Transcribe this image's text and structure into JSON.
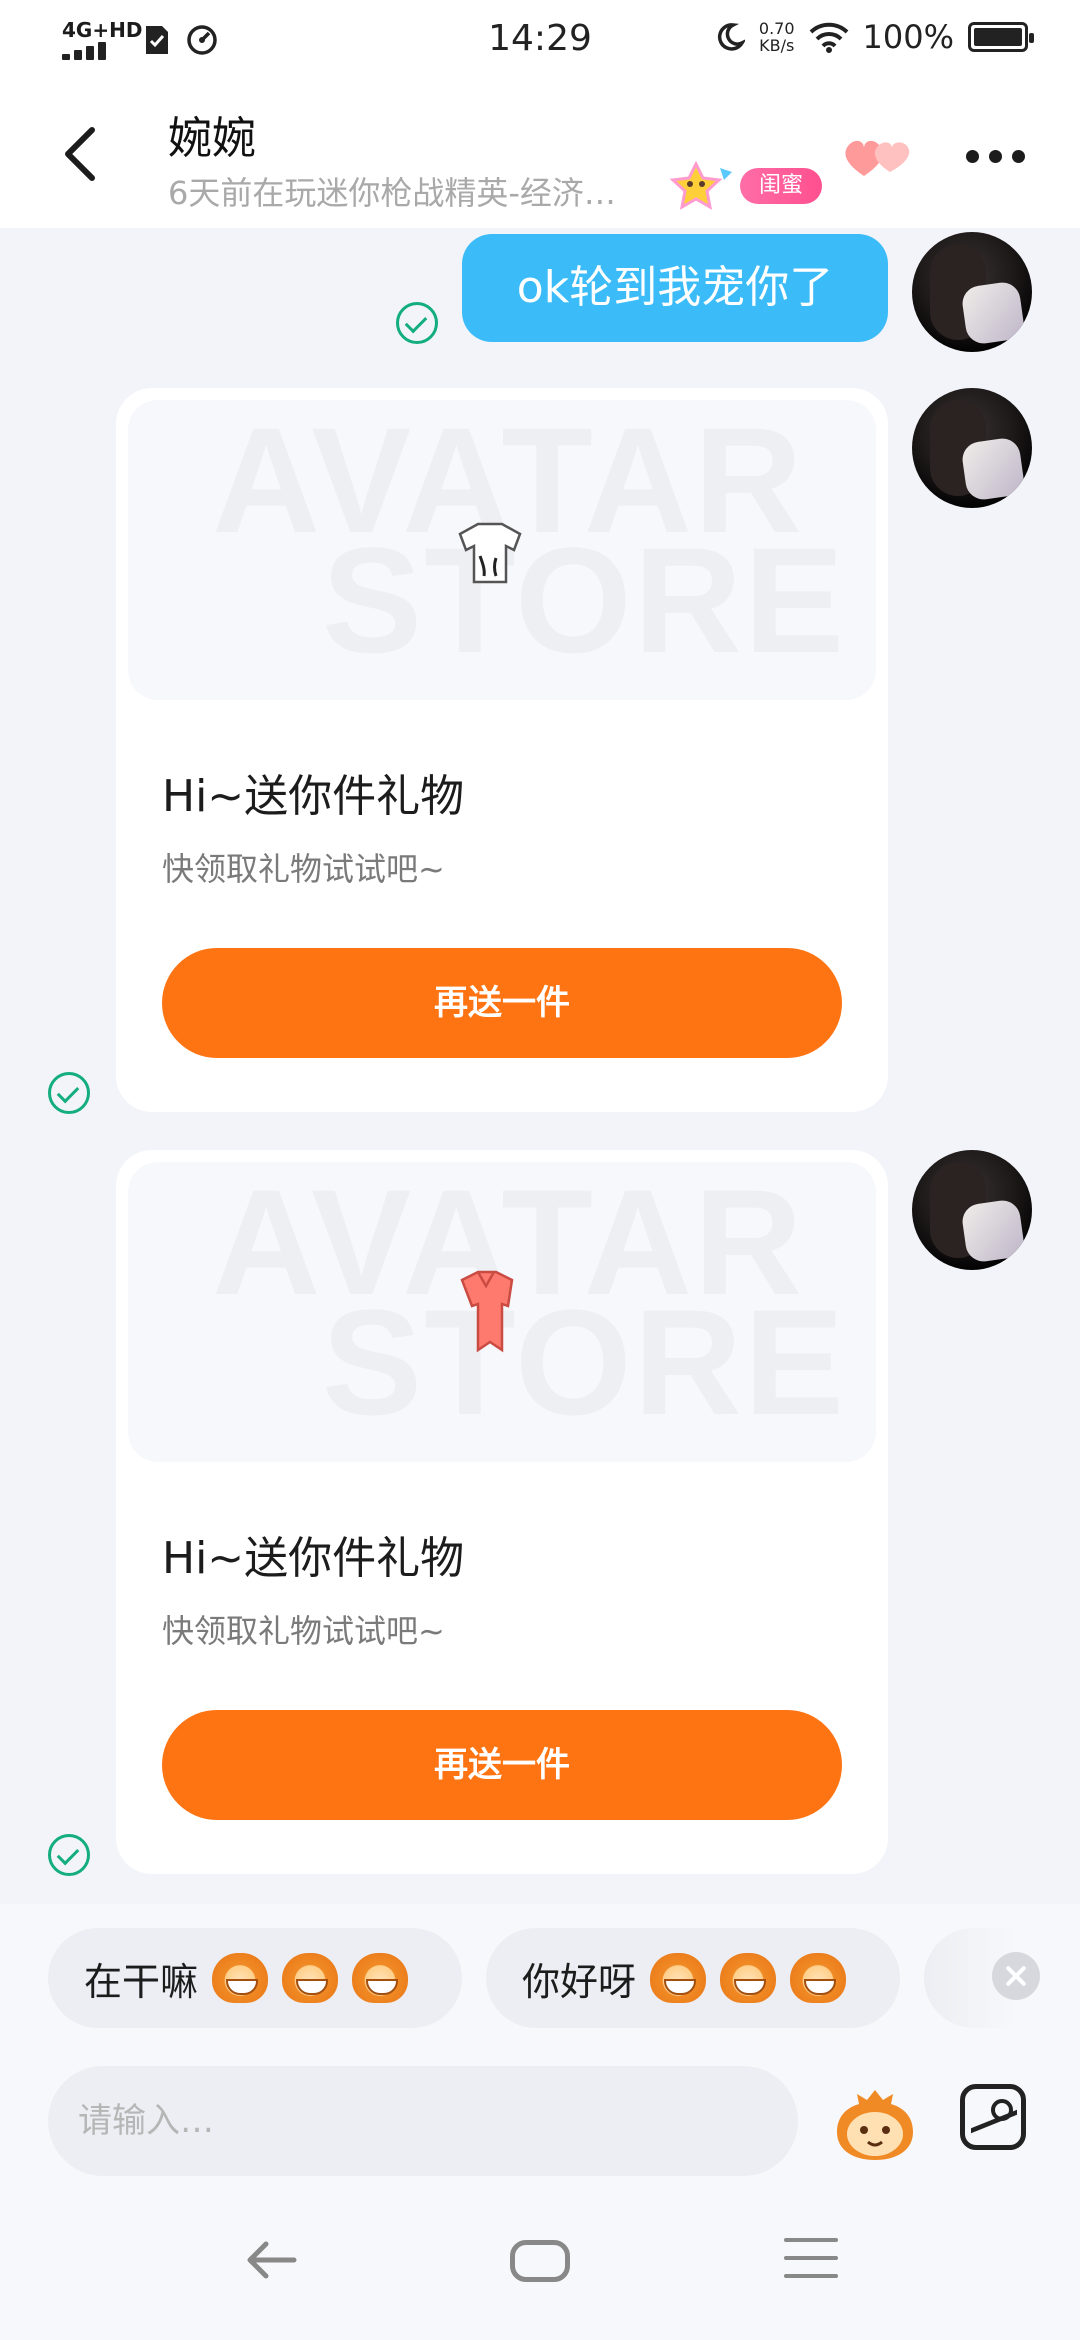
{
  "status_bar": {
    "network": "4G+HD",
    "time": "14:29",
    "speed_value": "0.70",
    "speed_unit": "KB/s",
    "battery": "100%"
  },
  "header": {
    "name": "婉婉",
    "subtitle": "6天前在玩迷你枪战精英-经济…",
    "relation_badge": "闺蜜"
  },
  "messages": {
    "text_bubble": "ok轮到我宠你了",
    "gift_cards": [
      {
        "watermark_line1": "AVATAR",
        "watermark_line2": "STORE",
        "title": "Hi~送你件礼物",
        "desc": "快领取礼物试试吧~",
        "button": "再送一件",
        "item_icon": "white-crop-top-icon"
      },
      {
        "watermark_line1": "AVATAR",
        "watermark_line2": "STORE",
        "title": "Hi~送你件礼物",
        "desc": "快领取礼物试试吧~",
        "button": "再送一件",
        "item_icon": "red-shirt-icon"
      }
    ]
  },
  "quick_replies": [
    {
      "text": "在干嘛",
      "emoji": "monkey-grin-icon"
    },
    {
      "text": "你好呀",
      "emoji": "monkey-smile-icon"
    }
  ],
  "input": {
    "placeholder": "请输入…"
  },
  "colors": {
    "bubble": "#3bbcf8",
    "button": "#fe7413",
    "check": "#13ad80",
    "badge": "#ff4f8f"
  }
}
